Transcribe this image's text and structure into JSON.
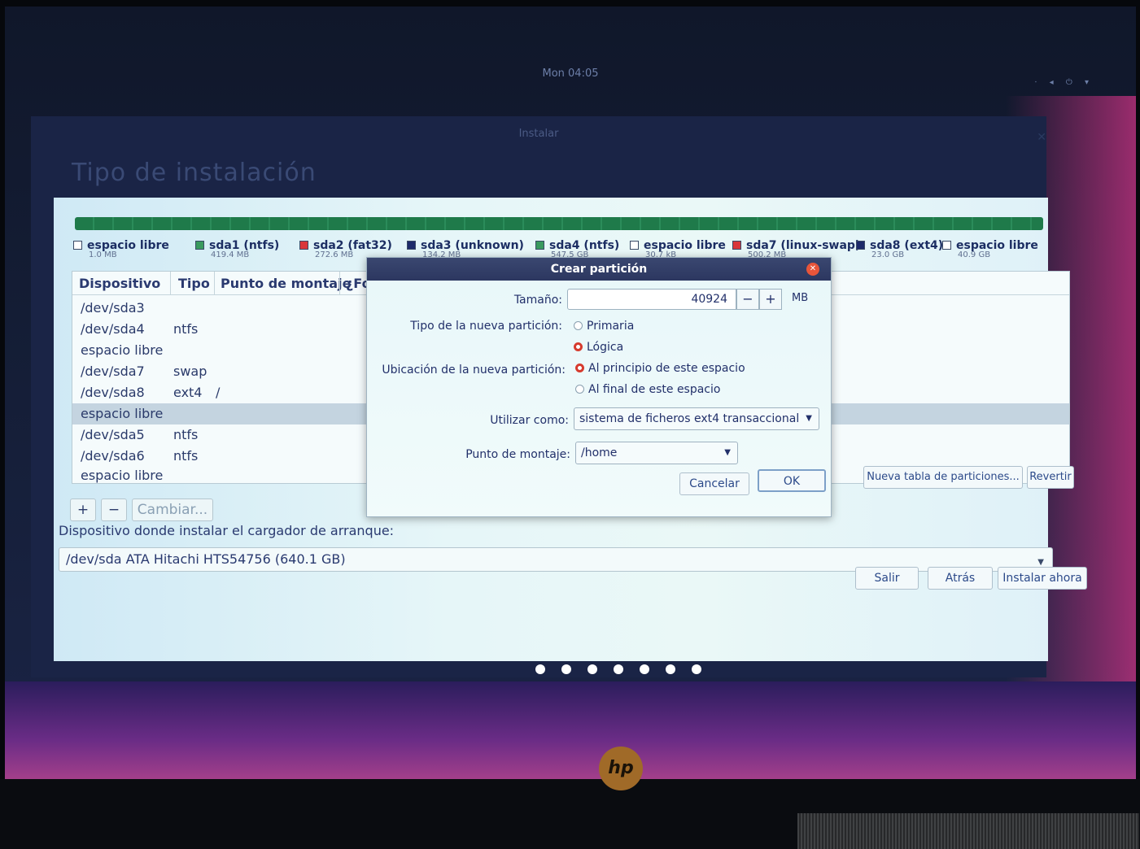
{
  "topbar": {
    "clock": "Mon 04:05",
    "tray": "⋅ ◂ ⏻ ▾"
  },
  "window": {
    "title": "Instalar",
    "heading": "Tipo de instalación"
  },
  "legend": [
    {
      "name": "espacio libre",
      "size": "1.0 MB",
      "color": "#ffffff"
    },
    {
      "name": "sda1 (ntfs)",
      "size": "419.4 MB",
      "color": "#3a9a5e"
    },
    {
      "name": "sda2 (fat32)",
      "size": "272.6 MB",
      "color": "#d9363a"
    },
    {
      "name": "sda3 (unknown)",
      "size": "134.2 MB",
      "color": "#1d2a6a"
    },
    {
      "name": "sda4 (ntfs)",
      "size": "547.5 GB",
      "color": "#3a9a5e"
    },
    {
      "name": "espacio libre",
      "size": "30.7 kB",
      "color": "#ffffff"
    },
    {
      "name": "sda7 (linux-swap)",
      "size": "500.2 MB",
      "color": "#d9363a"
    },
    {
      "name": "sda8 (ext4)",
      "size": "23.0 GB",
      "color": "#1d2a6a"
    },
    {
      "name": "espacio libre",
      "size": "40.9 GB",
      "color": "#ffffff"
    }
  ],
  "table": {
    "headers": {
      "device": "Dispositivo",
      "type": "Tipo",
      "mount": "Punto de montaje",
      "format": "¿Fo"
    },
    "rows": [
      {
        "device": "/dev/sda3",
        "type": "",
        "mount": ""
      },
      {
        "device": "/dev/sda4",
        "type": "ntfs",
        "mount": ""
      },
      {
        "device": "espacio libre",
        "type": "",
        "mount": ""
      },
      {
        "device": "/dev/sda7",
        "type": "swap",
        "mount": ""
      },
      {
        "device": "/dev/sda8",
        "type": "ext4",
        "mount": "/"
      },
      {
        "device": "espacio libre",
        "type": "",
        "mount": ""
      },
      {
        "device": "/dev/sda5",
        "type": "ntfs",
        "mount": ""
      },
      {
        "device": "/dev/sda6",
        "type": "ntfs",
        "mount": ""
      },
      {
        "device": "espacio libre",
        "type": "",
        "mount": ""
      }
    ]
  },
  "toolbar": {
    "add": "+",
    "remove": "−",
    "change": "Cambiar..."
  },
  "partition_buttons": {
    "new_table": "Nueva tabla de particiones...",
    "revert": "Revertir"
  },
  "bootloader": {
    "label": "Dispositivo donde instalar el cargador de arranque:",
    "value": "/dev/sda   ATA Hitachi HTS54756 (640.1 GB)"
  },
  "footer_buttons": {
    "quit": "Salir",
    "back": "Atrás",
    "install": "Instalar ahora"
  },
  "dialog": {
    "title": "Crear partición",
    "size_label": "Tamaño:",
    "size_value": "40924",
    "size_unit": "MB",
    "minus": "−",
    "plus": "+",
    "type_label": "Tipo de la nueva partición:",
    "type_primary": "Primaria",
    "type_logical": "Lógica",
    "location_label": "Ubicación de la nueva partición:",
    "location_start": "Al principio de este espacio",
    "location_end": "Al final de este espacio",
    "use_as_label": "Utilizar como:",
    "use_as_value": "sistema de ficheros ext4 transaccional",
    "mount_label": "Punto de montaje:",
    "mount_value": "/home",
    "cancel": "Cancelar",
    "ok": "OK"
  },
  "brand": {
    "logo": "hp"
  }
}
